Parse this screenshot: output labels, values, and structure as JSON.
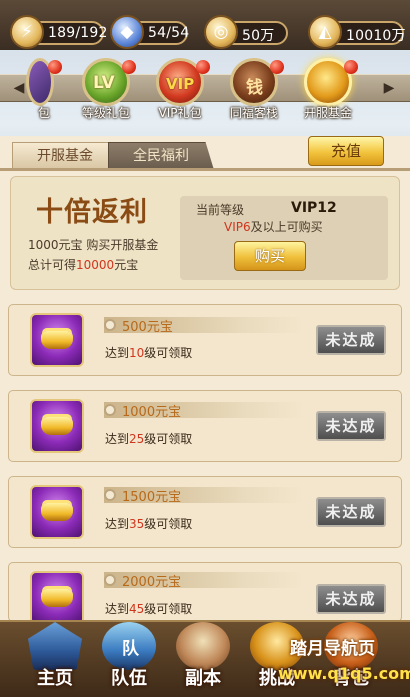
{
  "resources": [
    {
      "icon": "lightning-icon",
      "value": "189/192"
    },
    {
      "icon": "gem-icon",
      "value": "54/54"
    },
    {
      "icon": "coin-icon",
      "value": "50万"
    },
    {
      "icon": "gold-ingot-icon",
      "value": "10010万"
    }
  ],
  "nav": {
    "items": [
      {
        "label": "包"
      },
      {
        "label": "等级礼包"
      },
      {
        "label": "VIP礼包"
      },
      {
        "label": "同福客栈"
      },
      {
        "label": "开服基金"
      }
    ],
    "icon_texts": {
      "level": "LV",
      "vip": "VIP",
      "inn": "钱"
    }
  },
  "tabs": [
    "开服基金",
    "全民福利"
  ],
  "recharge_label": "充值",
  "hero": {
    "title": "十倍返利",
    "line1_amount": "1000",
    "line1_text": "元宝  购买开服基金",
    "line2_prefix": "总计可得",
    "line2_amount": "10000",
    "line2_suffix": "元宝",
    "current_level_label": "当前等级",
    "current_vip": "VIP12",
    "requirement_vip": "VIP6",
    "requirement_text": "及以上可购买",
    "buy_label": "购买"
  },
  "rows": [
    {
      "amount": "500元宝",
      "req_prefix": "达到",
      "req_level": "10",
      "req_suffix": "级可领取",
      "status": "未达成"
    },
    {
      "amount": "1000元宝",
      "req_prefix": "达到",
      "req_level": "25",
      "req_suffix": "级可领取",
      "status": "未达成"
    },
    {
      "amount": "1500元宝",
      "req_prefix": "达到",
      "req_level": "35",
      "req_suffix": "级可领取",
      "status": "未达成"
    },
    {
      "amount": "2000元宝",
      "req_prefix": "达到",
      "req_level": "45",
      "req_suffix": "级可领取",
      "status": "未达成"
    }
  ],
  "bottom_nav": [
    "主页",
    "队伍",
    "副本",
    "挑战",
    "背包"
  ],
  "bottom_icon_texts": {
    "team": "队"
  },
  "watermark": {
    "line1": "踏月导航页",
    "line2": "www.q1q5.com"
  },
  "colors": {
    "accent_gold": "#f2c43d",
    "status_gray": "#6e6e6e",
    "highlight_red": "#d0351e",
    "panel_bg": "#f4ead5"
  }
}
